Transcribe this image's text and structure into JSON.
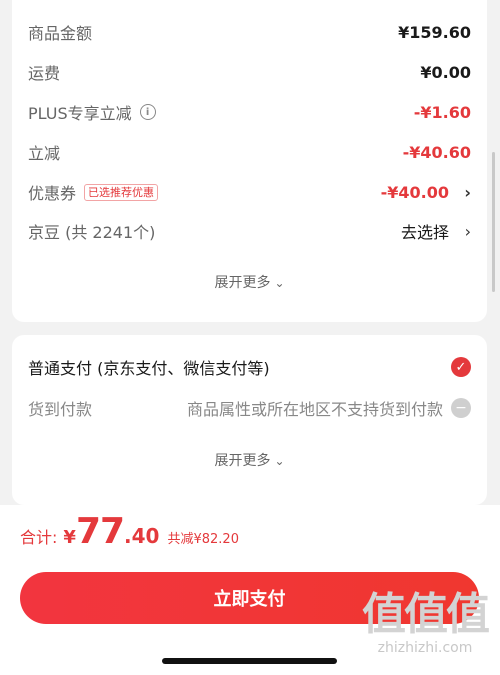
{
  "summary": {
    "rows": [
      {
        "label": "商品金额",
        "value": "¥159.60"
      },
      {
        "label": "运费",
        "value": "¥0.00"
      },
      {
        "label": "PLUS专享立减",
        "value": "-¥1.60"
      },
      {
        "label": "立减",
        "value": "-¥40.60"
      },
      {
        "label": "优惠券",
        "tag": "已选推荐优惠",
        "value": "-¥40.00"
      },
      {
        "label": "京豆 (共 2241个)",
        "value": "去选择"
      }
    ],
    "expand": "展开更多"
  },
  "payment": {
    "option1": "普通支付 (京东支付、微信支付等)",
    "option2_label": "货到付款",
    "option2_note": "商品属性或所在地区不支持货到付款",
    "expand": "展开更多"
  },
  "footer": {
    "total_label": "合计:",
    "currency": "¥",
    "total_int": "77",
    "total_dec": ".40",
    "saving": "共减¥82.20",
    "pay_button": "立即支付"
  },
  "watermark": {
    "big": "值值值",
    "small": "zhizhizhi.com"
  },
  "colors": {
    "accent": "#e4393c"
  },
  "icons": [
    "info-icon",
    "chevron-right-icon",
    "check-circle-icon",
    "minus-circle-icon",
    "chevron-down-icon"
  ]
}
